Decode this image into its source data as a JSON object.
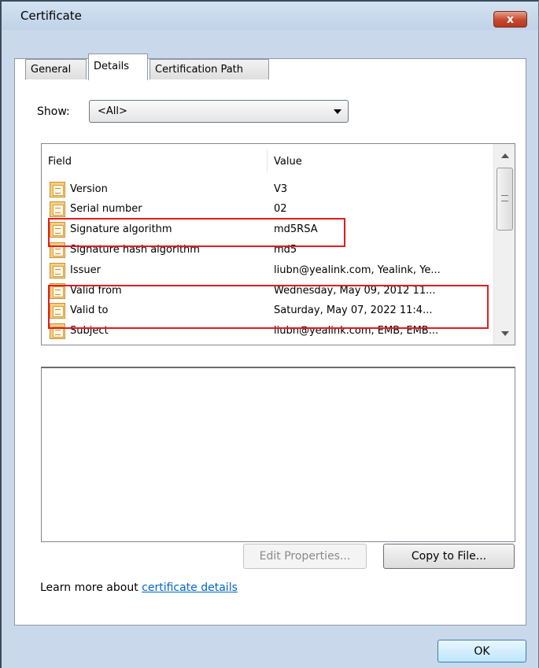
{
  "window": {
    "title": "Certificate",
    "close_label": "x"
  },
  "tabs": [
    {
      "label": "General",
      "active": false
    },
    {
      "label": "Details",
      "active": true
    },
    {
      "label": "Certification Path",
      "active": false
    }
  ],
  "show": {
    "label": "Show:",
    "value": "<All>"
  },
  "list": {
    "columns": {
      "field": "Field",
      "value": "Value"
    },
    "rows": [
      {
        "field": "Version",
        "value": "V3"
      },
      {
        "field": "Serial number",
        "value": "02"
      },
      {
        "field": "Signature algorithm",
        "value": "md5RSA"
      },
      {
        "field": "Signature hash algorithm",
        "value": "md5"
      },
      {
        "field": "Issuer",
        "value": "liubn@yealink.com, Yealink, Ye..."
      },
      {
        "field": "Valid from",
        "value": "Wednesday, May 09, 2012 11..."
      },
      {
        "field": "Valid to",
        "value": "Saturday, May 07, 2022 11:4..."
      },
      {
        "field": "Subject",
        "value": "liubn@yealink.com, EMB, EMB..."
      }
    ]
  },
  "buttons": {
    "edit": "Edit Properties...",
    "copy": "Copy to File...",
    "ok": "OK"
  },
  "learn": {
    "prefix": "Learn more about ",
    "link": "certificate details"
  },
  "colors": {
    "highlight_box": "#e21b23",
    "link": "#0066cc"
  }
}
